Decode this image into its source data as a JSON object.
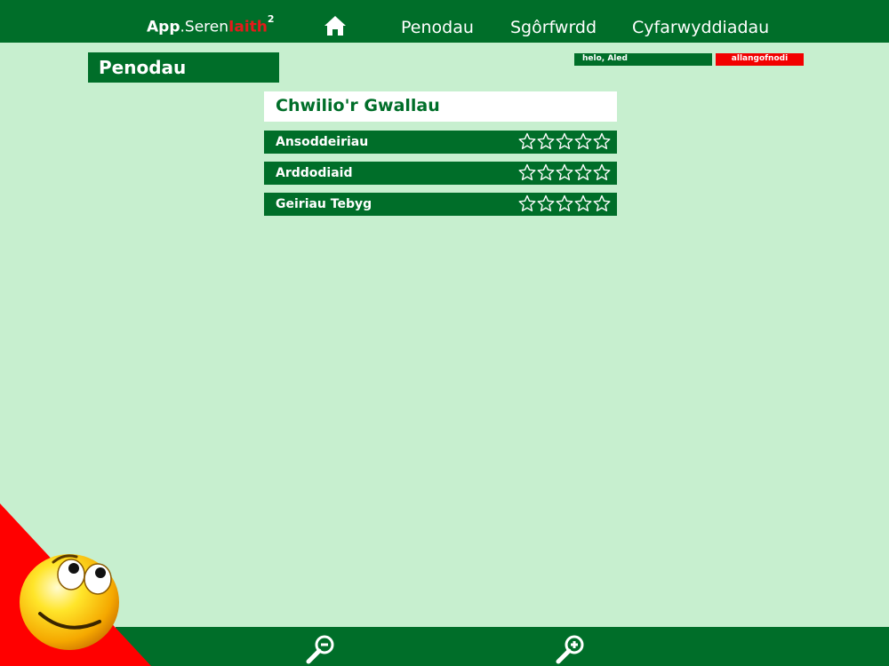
{
  "app": {
    "logo_part1": "App",
    "logo_dot": ".",
    "logo_part2": "Seren",
    "logo_part3": "Iaith",
    "logo_sup": "2"
  },
  "nav": {
    "home_icon": "home-icon",
    "items": [
      "Penodau",
      "Sgôrfwrdd",
      "Cyfarwyddiadau"
    ]
  },
  "header": {
    "page_title": "Penodau",
    "greeting": "helo, Aled",
    "logout": "allangofnodi"
  },
  "section": {
    "title": "Chwilio'r Gwallau",
    "chapters": [
      {
        "label": "Ansoddeiriau",
        "stars_filled": 0,
        "stars_total": 5
      },
      {
        "label": "Arddodiaid",
        "stars_filled": 0,
        "stars_total": 5
      },
      {
        "label": "Geiriau Tebyg",
        "stars_filled": 0,
        "stars_total": 5
      }
    ]
  },
  "footer": {
    "zoom_out_icon": "zoom-out-icon",
    "zoom_in_icon": "zoom-in-icon"
  },
  "colors": {
    "primary_green": "#006e29",
    "background": "#c7efcf",
    "accent_red": "#f20000"
  }
}
